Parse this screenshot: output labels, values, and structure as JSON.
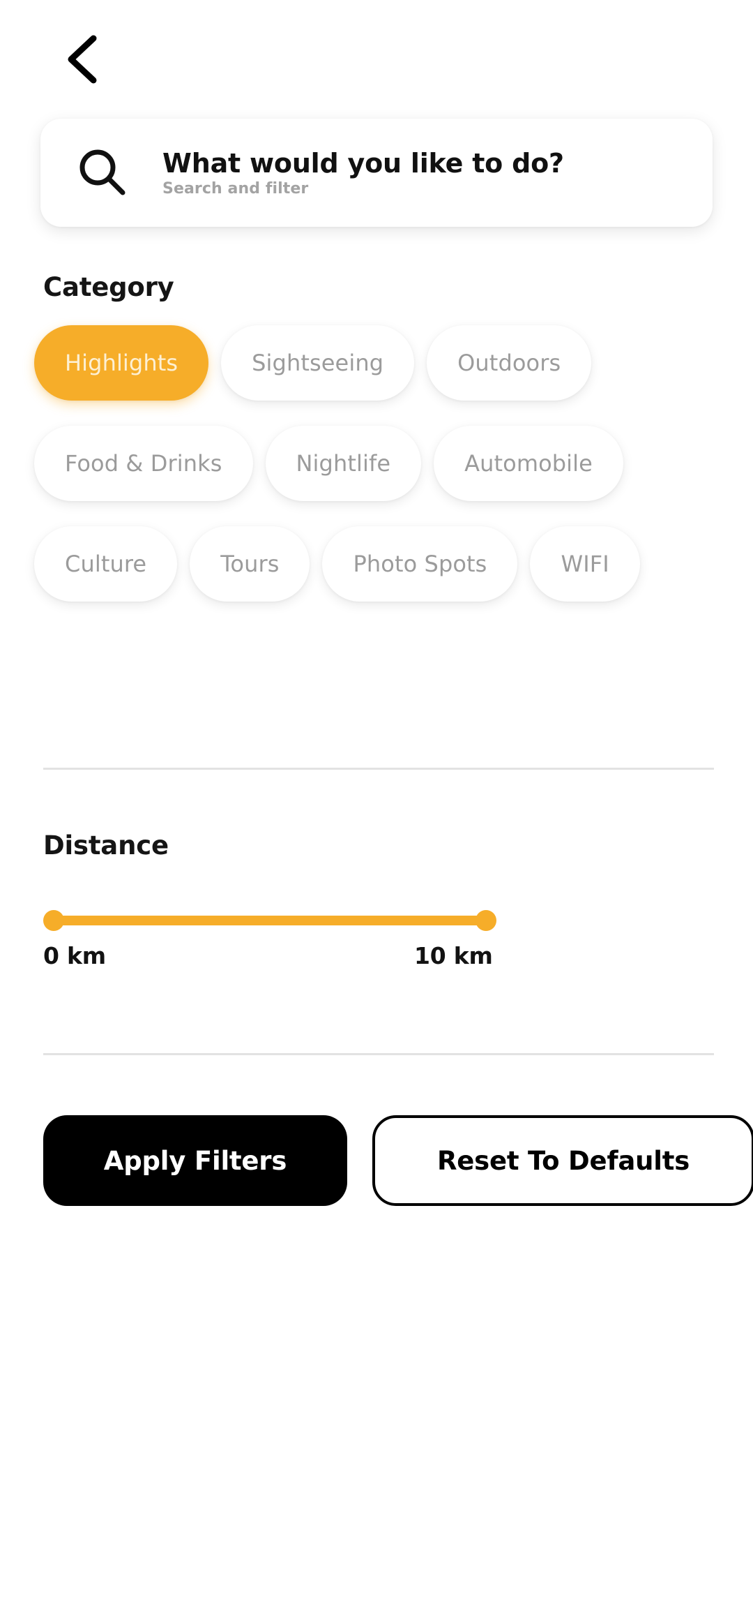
{
  "nav": {
    "back_icon": "chevron-left-icon"
  },
  "search": {
    "icon": "search-icon",
    "title": "What would you like to do?",
    "subtitle": "Search and filter"
  },
  "category": {
    "title": "Category",
    "chips": [
      {
        "label": "Highlights",
        "selected": true
      },
      {
        "label": "Sightseeing",
        "selected": false
      },
      {
        "label": "Outdoors",
        "selected": false
      },
      {
        "label": "Food & Drinks",
        "selected": false
      },
      {
        "label": "Nightlife",
        "selected": false
      },
      {
        "label": "Automobile",
        "selected": false
      },
      {
        "label": "Culture",
        "selected": false
      },
      {
        "label": "Tours",
        "selected": false
      },
      {
        "label": "Photo Spots",
        "selected": false
      },
      {
        "label": "WIFI",
        "selected": false
      }
    ]
  },
  "distance": {
    "title": "Distance",
    "min_label": "0 km",
    "max_label": "10 km",
    "min_value": 0,
    "max_value": 10,
    "unit": "km"
  },
  "actions": {
    "apply_label": "Apply Filters",
    "reset_label": "Reset To Defaults"
  },
  "colors": {
    "accent": "#f6ad29",
    "accent_text": "#fdf0d4",
    "chip_text": "#9b9b9b",
    "primary_button_bg": "#000000",
    "primary_button_text": "#ffffff",
    "divider": "#e2e2e2",
    "page_background": "#ffffff"
  }
}
